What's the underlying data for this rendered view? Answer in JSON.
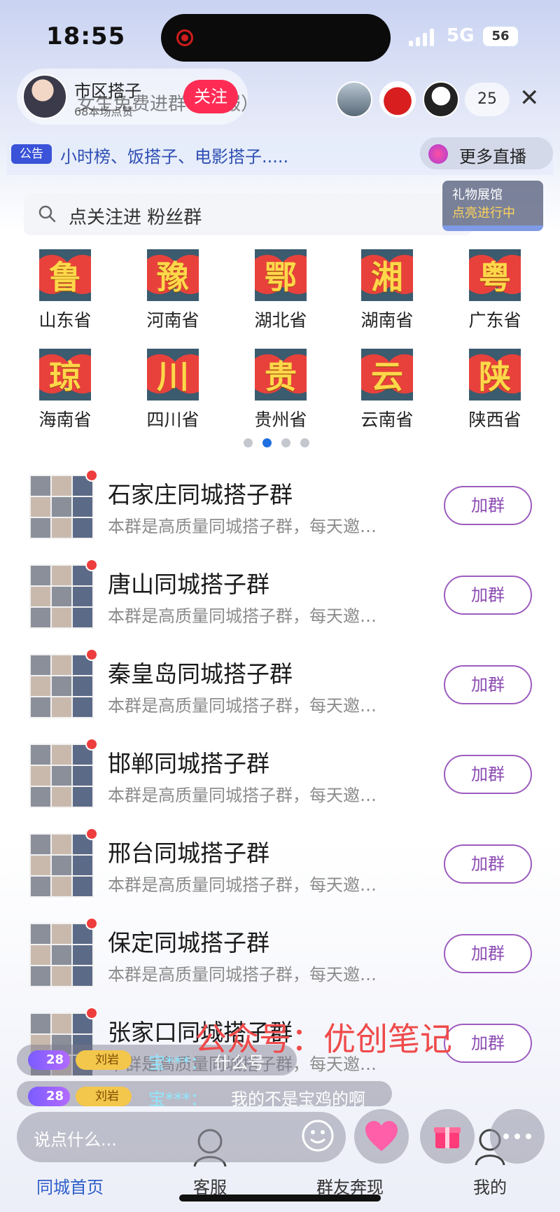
{
  "status_bar": {
    "time": "18:55",
    "network": "5G",
    "battery": "56"
  },
  "live_header": {
    "host_name": "市区搭子",
    "host_sub": "68本场点赞",
    "follow_label": "关注",
    "title_overlay": "女生免费进群（客服）",
    "viewer_count": "25",
    "close_icon": "close-icon"
  },
  "notice": {
    "badge": "公告",
    "text": "小时榜、饭搭子、电影搭子....."
  },
  "more_live": {
    "label": "更多直播"
  },
  "gift_hall": {
    "title": "礼物展馆",
    "status": "点亮进行中"
  },
  "search": {
    "placeholder": "点关注进    粉丝群"
  },
  "provinces": [
    {
      "char": "鲁",
      "name": "山东省"
    },
    {
      "char": "豫",
      "name": "河南省"
    },
    {
      "char": "鄂",
      "name": "湖北省"
    },
    {
      "char": "湘",
      "name": "湖南省"
    },
    {
      "char": "粤",
      "name": "广东省"
    },
    {
      "char": "琼",
      "name": "海南省"
    },
    {
      "char": "川",
      "name": "四川省"
    },
    {
      "char": "贵",
      "name": "贵州省"
    },
    {
      "char": "云",
      "name": "云南省"
    },
    {
      "char": "陕",
      "name": "陕西省"
    }
  ],
  "pager": {
    "pages": 4,
    "active": 2
  },
  "groups": [
    {
      "name": "石家庄同城搭子群",
      "desc": "本群是高质量同城搭子群，每天邀…",
      "join_label": "加群"
    },
    {
      "name": "唐山同城搭子群",
      "desc": "本群是高质量同城搭子群，每天邀…",
      "join_label": "加群"
    },
    {
      "name": "秦皇岛同城搭子群",
      "desc": "本群是高质量同城搭子群，每天邀…",
      "join_label": "加群"
    },
    {
      "name": "邯郸同城搭子群",
      "desc": "本群是高质量同城搭子群，每天邀…",
      "join_label": "加群"
    },
    {
      "name": "邢台同城搭子群",
      "desc": "本群是高质量同城搭子群，每天邀…",
      "join_label": "加群"
    },
    {
      "name": "保定同城搭子群",
      "desc": "本群是高质量同城搭子群，每天邀…",
      "join_label": "加群"
    },
    {
      "name": "张家口同城搭子群",
      "desc": "本群是高质量同城搭子群，每天邀…",
      "join_label": "加群"
    }
  ],
  "comments": [
    {
      "level": "28",
      "fan": "刘岩",
      "user": "宝***：",
      "text": "什么号"
    },
    {
      "level": "28",
      "fan": "刘岩",
      "user": "宝***：",
      "text": "我的不是宝鸡的啊"
    }
  ],
  "watermark": "公众号：优创笔记",
  "bottom": {
    "comment_placeholder": "说点什么...",
    "nav": [
      "同城首页",
      "客服",
      "群友奔现",
      "我的"
    ]
  },
  "colors": {
    "accent": "#2e5ec9",
    "follow": "#fe2c55",
    "join_border": "#9d5cbf",
    "unread": "#ee3d3d"
  }
}
